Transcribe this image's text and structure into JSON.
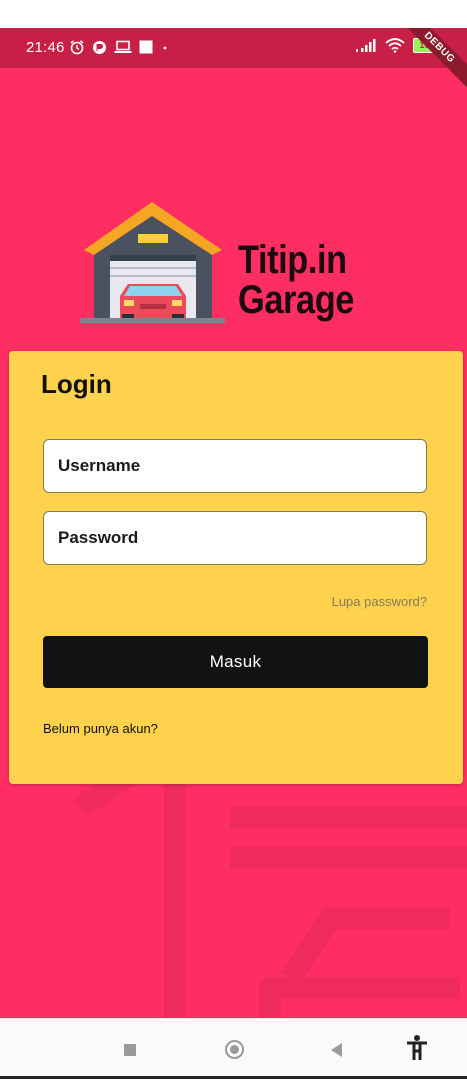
{
  "status_bar": {
    "time": "21:46",
    "battery": "100",
    "debug_label": "DEBUG"
  },
  "logo": {
    "line1": "Titip.in",
    "line2": "Garage"
  },
  "login": {
    "title": "Login",
    "username_placeholder": "Username",
    "password_placeholder": "Password",
    "forgot_password": "Lupa password?",
    "submit_label": "Masuk",
    "signup_prompt": "Belum punya akun?"
  },
  "colors": {
    "background": "#fe2e63",
    "card": "#fed24d",
    "button": "#121212"
  },
  "icons": [
    "alarm-icon",
    "app-icon",
    "laptop-icon",
    "image-icon",
    "signal-icon",
    "wifi-icon",
    "battery-icon",
    "recents-icon",
    "home-icon",
    "back-icon",
    "accessibility-icon"
  ]
}
